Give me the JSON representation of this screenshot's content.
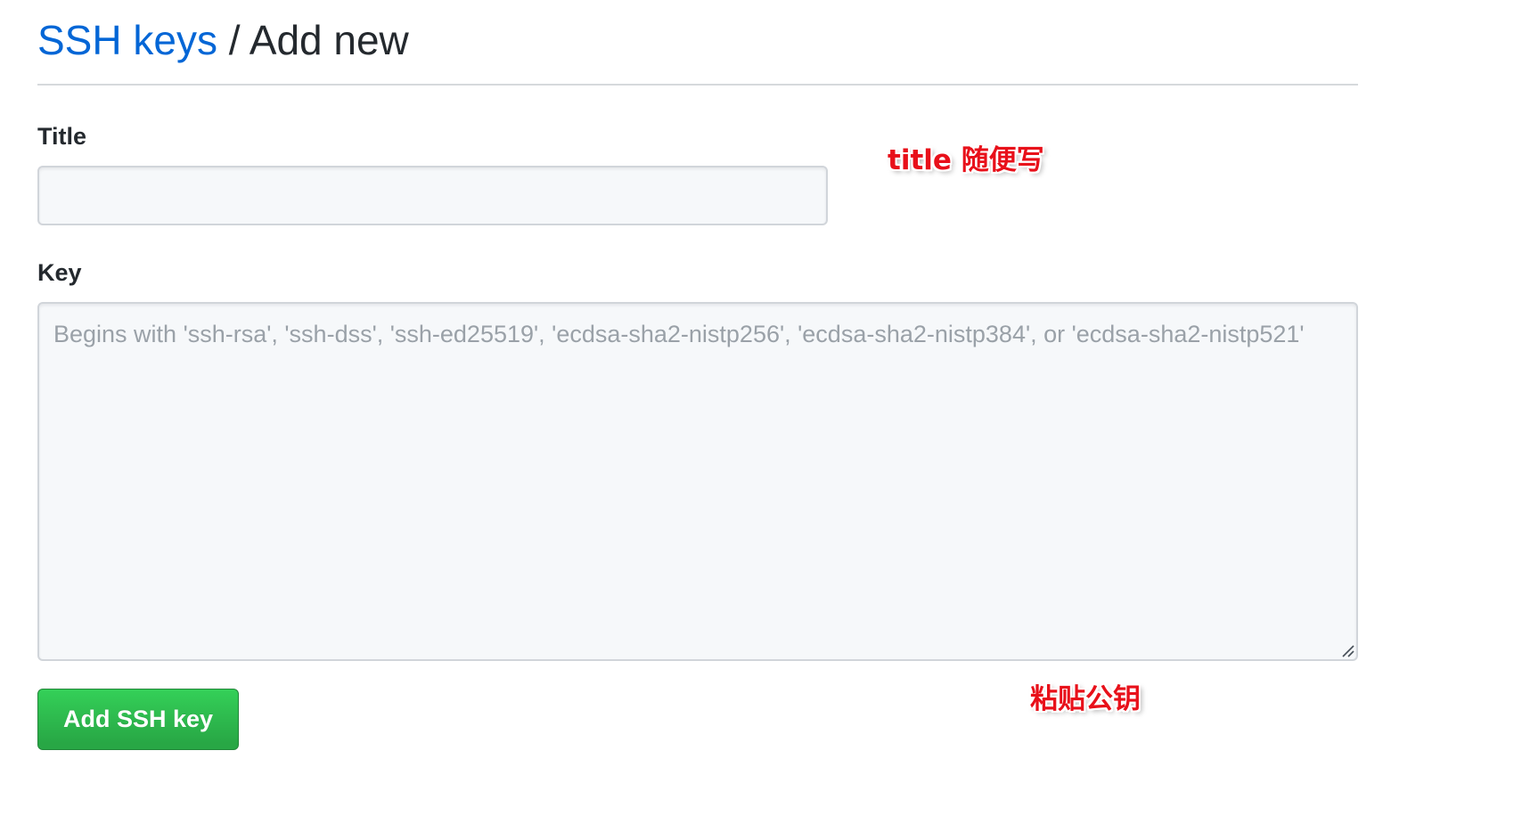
{
  "header": {
    "breadcrumb_link": "SSH keys",
    "separator": "/",
    "current_page": "Add new"
  },
  "form": {
    "title_label": "Title",
    "title_value": "",
    "key_label": "Key",
    "key_placeholder": "Begins with 'ssh-rsa', 'ssh-dss', 'ssh-ed25519', 'ecdsa-sha2-nistp256', 'ecdsa-sha2-nistp384', or 'ecdsa-sha2-nistp521'",
    "key_value": "",
    "submit_label": "Add SSH key"
  },
  "annotations": {
    "title_note": "title 随便写",
    "key_note": "粘贴公钥"
  },
  "colors": {
    "link": "#0366d6",
    "button": "#28a745",
    "annotation": "#e8101a"
  },
  "icons": {
    "resize_handle": "resize-handle-icon"
  }
}
